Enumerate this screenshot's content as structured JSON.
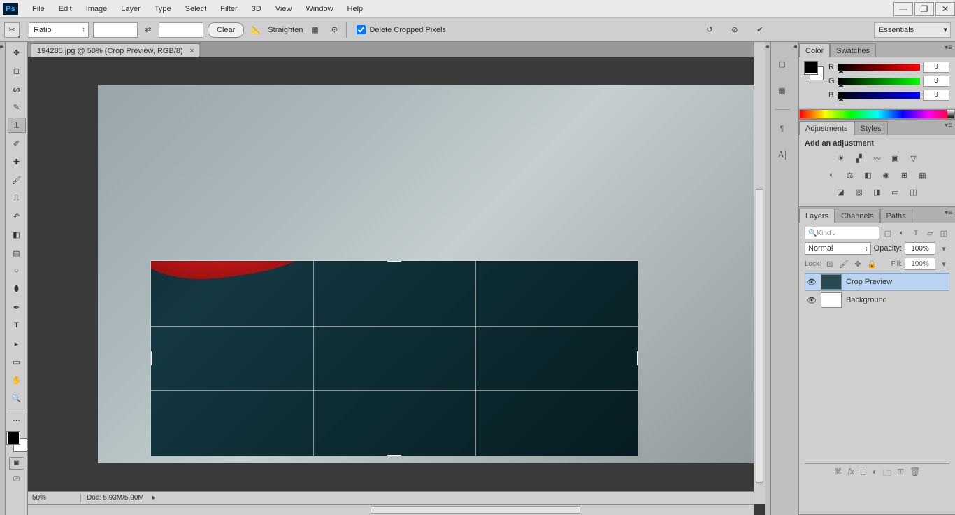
{
  "menu": {
    "items": [
      "File",
      "Edit",
      "Image",
      "Layer",
      "Type",
      "Select",
      "Filter",
      "3D",
      "View",
      "Window",
      "Help"
    ]
  },
  "options": {
    "ratio_label": "Ratio",
    "clear": "Clear",
    "straighten": "Straighten",
    "delete_cropped": "Delete Cropped Pixels"
  },
  "workspace": "Essentials",
  "document": {
    "tab": "194285.jpg @ 50% (Crop Preview, RGB/8)",
    "zoom": "50%",
    "docsize": "Doc: 5,93M/5,90M"
  },
  "panels": {
    "color": {
      "tab1": "Color",
      "tab2": "Swatches",
      "r": "R",
      "g": "G",
      "b": "B",
      "rv": "0",
      "gv": "0",
      "bv": "0"
    },
    "adjustments": {
      "tab1": "Adjustments",
      "tab2": "Styles",
      "title": "Add an adjustment"
    },
    "layers": {
      "tab1": "Layers",
      "tab2": "Channels",
      "tab3": "Paths",
      "kind": "Kind",
      "blend": "Normal",
      "opacity_label": "Opacity:",
      "opacity": "100%",
      "lock": "Lock:",
      "fill_label": "Fill:",
      "fill": "100%",
      "items": [
        {
          "name": "Crop Preview"
        },
        {
          "name": "Background"
        }
      ]
    }
  }
}
